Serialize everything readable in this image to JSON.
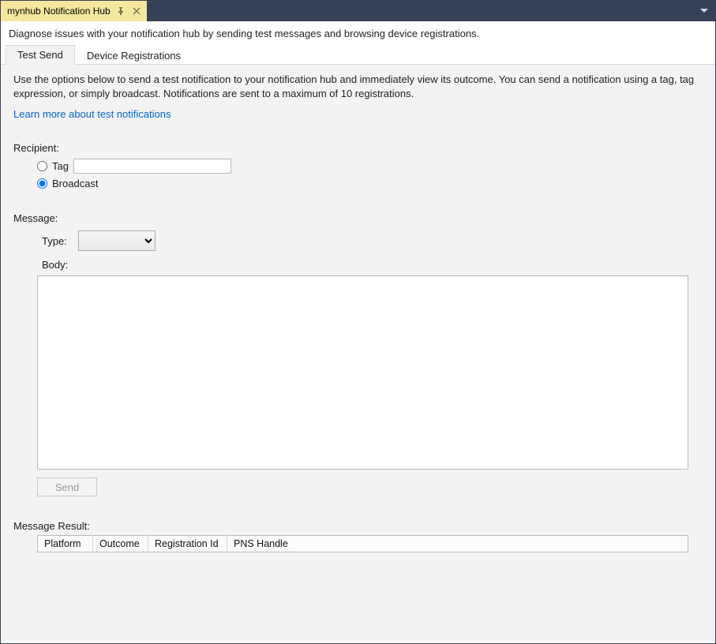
{
  "titlebar": {
    "tab_title": "mynhub Notification Hub"
  },
  "description": "Diagnose issues with your notification hub by sending test messages and browsing device registrations.",
  "tabs": {
    "test_send": "Test Send",
    "device_registrations": "Device Registrations"
  },
  "intro": "Use the options below to send a test notification to your notification hub and immediately view its outcome. You can send a notification using a tag, tag expression, or simply broadcast. Notifications are sent to a maximum of 10 registrations.",
  "learn_more": "Learn more about test notifications",
  "recipient": {
    "label": "Recipient:",
    "tag_label": "Tag",
    "tag_value": "",
    "broadcast_label": "Broadcast",
    "selected": "broadcast"
  },
  "message": {
    "label": "Message:",
    "type_label": "Type:",
    "type_value": "",
    "body_label": "Body:",
    "body_value": "",
    "send_label": "Send"
  },
  "result": {
    "label": "Message Result:",
    "columns": {
      "platform": "Platform",
      "outcome": "Outcome",
      "registration_id": "Registration Id",
      "pns_handle": "PNS Handle"
    }
  }
}
